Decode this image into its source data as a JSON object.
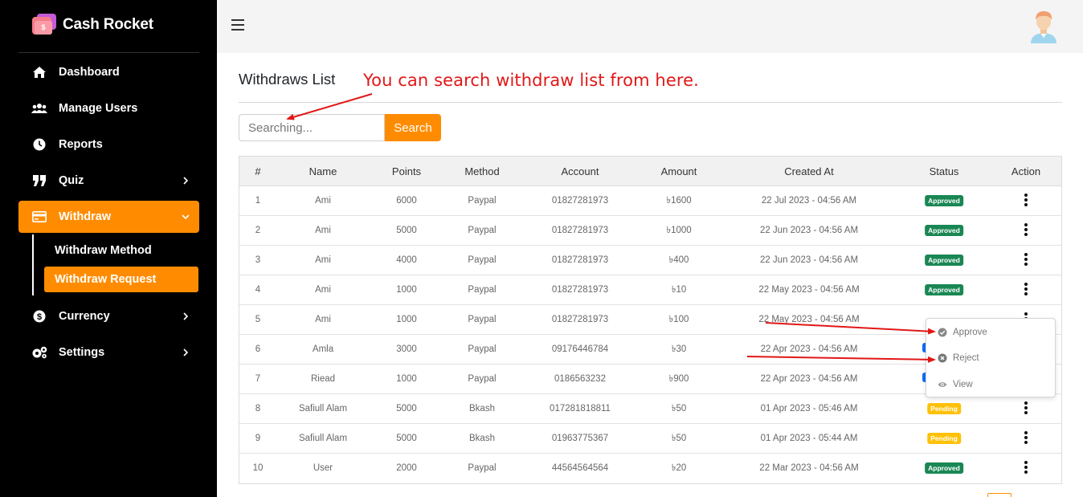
{
  "brand": {
    "name": "Cash Rocket",
    "logo_icon": "wallet-cash-icon"
  },
  "sidebar": {
    "items": [
      {
        "label": "Dashboard",
        "icon": "home-icon"
      },
      {
        "label": "Manage Users",
        "icon": "users-icon"
      },
      {
        "label": "Reports",
        "icon": "clock-icon"
      },
      {
        "label": "Quiz",
        "icon": "quote-icon"
      },
      {
        "label": "Withdraw",
        "icon": "credit-card-icon"
      },
      {
        "label": "Currency",
        "icon": "dollar-circle-icon"
      },
      {
        "label": "Settings",
        "icon": "gears-icon"
      }
    ],
    "withdraw_sub": [
      {
        "label": "Withdraw Method"
      },
      {
        "label": "Withdraw Request"
      }
    ],
    "accent": "#ff8c00"
  },
  "header": {
    "menu_icon": "hamburger-icon",
    "avatar_icon": "user-avatar-icon"
  },
  "main": {
    "title": "Withdraws List",
    "annotation": "You can search withdraw list from here.",
    "search": {
      "placeholder": "Searching...",
      "button_label": "Search"
    }
  },
  "table": {
    "headers": [
      "#",
      "Name",
      "Points",
      "Method",
      "Account",
      "Amount",
      "Created At",
      "Status",
      "Action"
    ],
    "rows": [
      {
        "no": "1",
        "name": "Ami",
        "points": "6000",
        "method": "Paypal",
        "account": "01827281973",
        "amount": "৳1600",
        "created": "22 Jul 2023 - 04:56 AM",
        "status": "Approved"
      },
      {
        "no": "2",
        "name": "Ami",
        "points": "5000",
        "method": "Paypal",
        "account": "01827281973",
        "amount": "৳1000",
        "created": "22 Jun 2023 - 04:56 AM",
        "status": "Approved"
      },
      {
        "no": "3",
        "name": "Ami",
        "points": "4000",
        "method": "Paypal",
        "account": "01827281973",
        "amount": "৳400",
        "created": "22 Jun 2023 - 04:56 AM",
        "status": "Approved"
      },
      {
        "no": "4",
        "name": "Ami",
        "points": "1000",
        "method": "Paypal",
        "account": "01827281973",
        "amount": "৳10",
        "created": "22 May 2023 - 04:56 AM",
        "status": "Approved"
      },
      {
        "no": "5",
        "name": "Ami",
        "points": "1000",
        "method": "Paypal",
        "account": "01827281973",
        "amount": "৳100",
        "created": "22 May 2023 - 04:56 AM",
        "status": ""
      },
      {
        "no": "6",
        "name": "Amla",
        "points": "3000",
        "method": "Paypal",
        "account": "09176446784",
        "amount": "৳30",
        "created": "22 Apr 2023 - 04:56 AM",
        "status": ""
      },
      {
        "no": "7",
        "name": "Riead",
        "points": "1000",
        "method": "Paypal",
        "account": "0186563232",
        "amount": "৳900",
        "created": "22 Apr 2023 - 04:56 AM",
        "status": ""
      },
      {
        "no": "8",
        "name": "Safiull Alam",
        "points": "5000",
        "method": "Bkash",
        "account": "017281818811",
        "amount": "৳50",
        "created": "01 Apr 2023 - 05:46 AM",
        "status": "Pending"
      },
      {
        "no": "9",
        "name": "Safiull Alam",
        "points": "5000",
        "method": "Bkash",
        "account": "01963775367",
        "amount": "৳50",
        "created": "01 Apr 2023 - 05:44 AM",
        "status": "Pending"
      },
      {
        "no": "10",
        "name": "User",
        "points": "2000",
        "method": "Paypal",
        "account": "44564564564",
        "amount": "৳20",
        "created": "22 Mar 2023 - 04:56 AM",
        "status": "Approved"
      }
    ],
    "status_colors": {
      "Approved": "#198754",
      "Pending": "#ffc107"
    }
  },
  "action_menu": {
    "items": [
      {
        "label": "Approve",
        "icon": "check-circle-icon"
      },
      {
        "label": "Reject",
        "icon": "x-circle-icon"
      },
      {
        "label": "View",
        "icon": "eye-icon"
      }
    ]
  },
  "annotation_color": "#e11717"
}
